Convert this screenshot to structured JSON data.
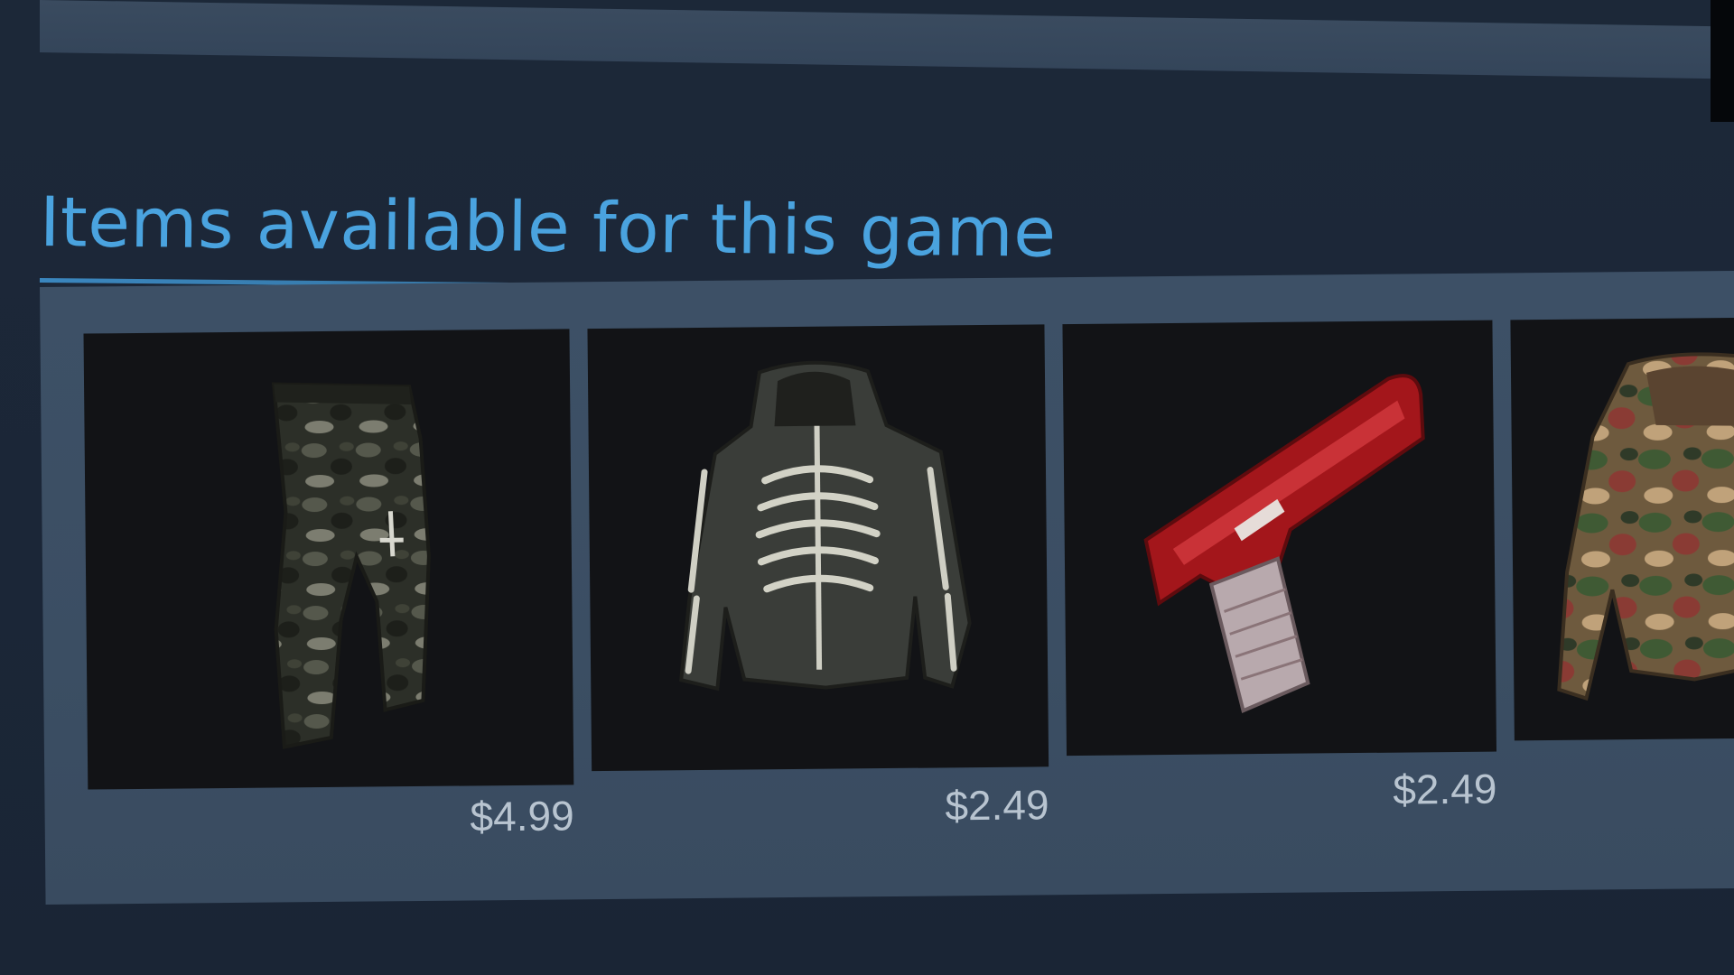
{
  "section": {
    "title": "Items available for this game"
  },
  "items": [
    {
      "name": "camo-pants",
      "price": "$4.99"
    },
    {
      "name": "skeleton-hoodie",
      "price": "$2.49"
    },
    {
      "name": "red-pistol",
      "price": "$2.49"
    },
    {
      "name": "camo-hoodie",
      "price": ""
    }
  ],
  "colors": {
    "background": "#1b2636",
    "title": "#4aa3df",
    "panel": "#3c4f65",
    "price": "#b8c4d0",
    "item_bg": "#121316"
  }
}
